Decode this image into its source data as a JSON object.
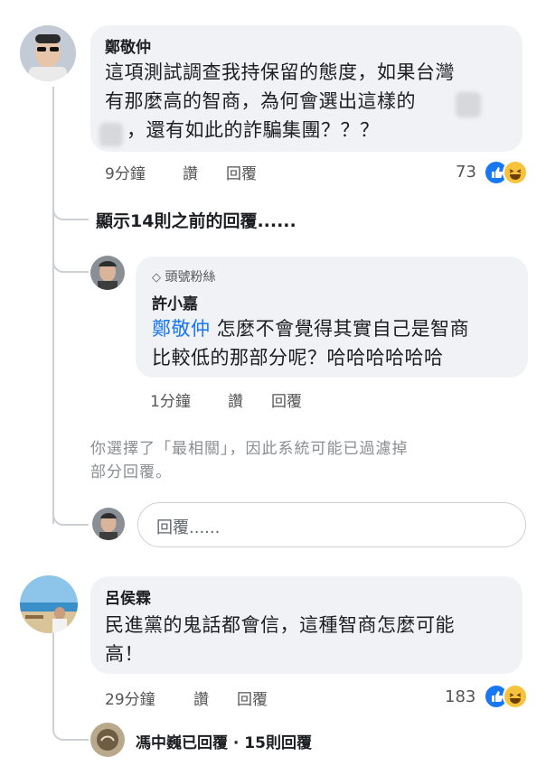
{
  "comment1": {
    "author": "鄭敬仲",
    "lines": [
      "這項測試調查我持保留的態度，如果台灣",
      "有那麼高的智商，為何會選出這樣的",
      "，還有如此的詐騙集團？？？"
    ],
    "time": "9分鐘",
    "like": "讚",
    "reply": "回覆",
    "reaction_count": "73"
  },
  "show_previous": "顯示14則之前的回覆......",
  "reply1": {
    "badge": "頭號粉絲",
    "author": "許小嘉",
    "mention": "鄭敬仲",
    "line1_rest": " 怎麼不會覺得其實自己是智商",
    "line2": "比較低的那部分呢？哈哈哈哈哈哈",
    "time": "1分鐘",
    "like": "讚",
    "reply": "回覆"
  },
  "filter_notice": [
    "你選擇了「最相關」，因此系統可能已過濾掉",
    "部分回覆。"
  ],
  "reply_input": {
    "placeholder": "回覆......"
  },
  "comment2": {
    "author": "呂侯霖",
    "lines": [
      "民進黨的鬼話都會信，這種智商怎麼可能",
      "高！"
    ],
    "time": "29分鐘",
    "like": "讚",
    "reply": "回覆",
    "reaction_count": "183"
  },
  "replied": {
    "text": "馮中巍已回覆 · 15則回覆"
  },
  "colors": {
    "mention": "#1877f2",
    "like": "#1877f2",
    "haha": "#f7c33c",
    "bubble": "#f0f2f5"
  }
}
